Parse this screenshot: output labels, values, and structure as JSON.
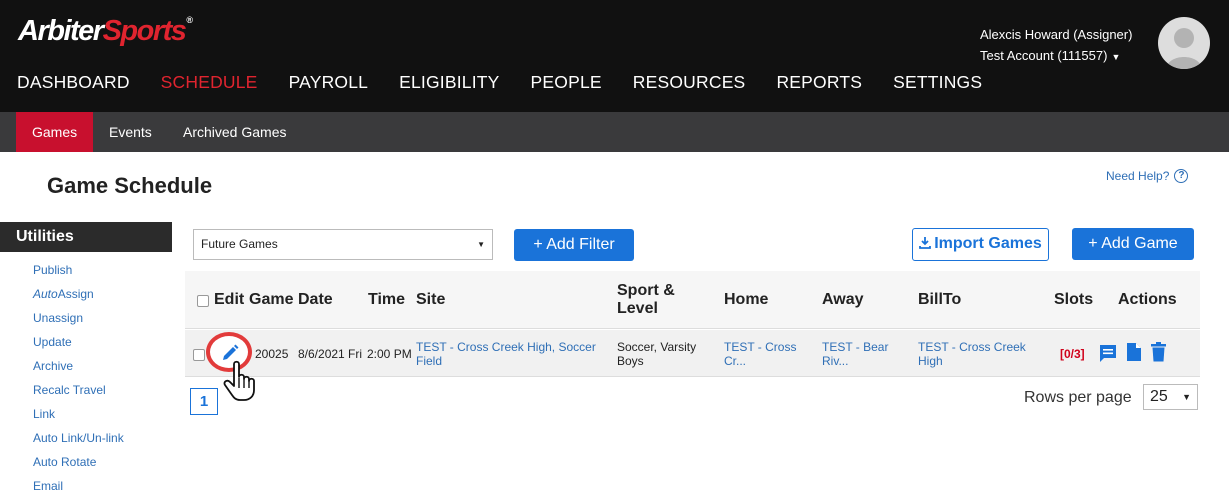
{
  "brand": {
    "part1": "Arbiter",
    "part2": "Sports"
  },
  "user": {
    "name": "Alexcis Howard (Assigner)",
    "account": "Test Account (111557)"
  },
  "main_nav": [
    "DASHBOARD",
    "SCHEDULE",
    "PAYROLL",
    "ELIGIBILITY",
    "PEOPLE",
    "RESOURCES",
    "REPORTS",
    "SETTINGS"
  ],
  "main_nav_active": "SCHEDULE",
  "sub_nav": [
    "Games",
    "Events",
    "Archived Games"
  ],
  "page_title": "Game Schedule",
  "help_label": "Need Help?",
  "utilities": {
    "title": "Utilities",
    "items": [
      {
        "label": "Publish"
      },
      {
        "italic": "Auto",
        "label": "Assign"
      },
      {
        "label": "Unassign"
      },
      {
        "label": "Update"
      },
      {
        "label": "Archive"
      },
      {
        "label": "Recalc Travel"
      },
      {
        "label": "Link"
      },
      {
        "label": "Auto Link/Un-link"
      },
      {
        "label": "Auto Rotate"
      },
      {
        "label": "Email"
      }
    ]
  },
  "filter": {
    "selected": "Future Games"
  },
  "buttons": {
    "add_filter": "+ Add Filter",
    "import_games": "Import Games",
    "add_game": "+ Add Game"
  },
  "table": {
    "headers": [
      "Edit",
      "Game",
      "Date",
      "Time",
      "Site",
      "Sport & Level",
      "Home",
      "Away",
      "BillTo",
      "Slots",
      "Actions"
    ],
    "rows": [
      {
        "game": "20025",
        "date": "8/6/2021 Fri",
        "time": "2:00 PM",
        "site": "TEST - Cross Creek High, Soccer Field",
        "sport_level": "Soccer, Varsity Boys",
        "home": "TEST - Cross Cr...",
        "away": "TEST - Bear Riv...",
        "billto": "TEST - Cross Creek High",
        "slots": "[0/3]",
        "actions": [
          "comment-icon",
          "document-icon",
          "trash-icon"
        ]
      }
    ]
  },
  "pagination": {
    "current_page": "1",
    "rows_label": "Rows per page",
    "rows_value": "25"
  },
  "colors": {
    "brand_red": "#e0242f",
    "link_blue": "#2f6fb6",
    "button_blue": "#1a73d9",
    "header_bg": "#111111"
  }
}
